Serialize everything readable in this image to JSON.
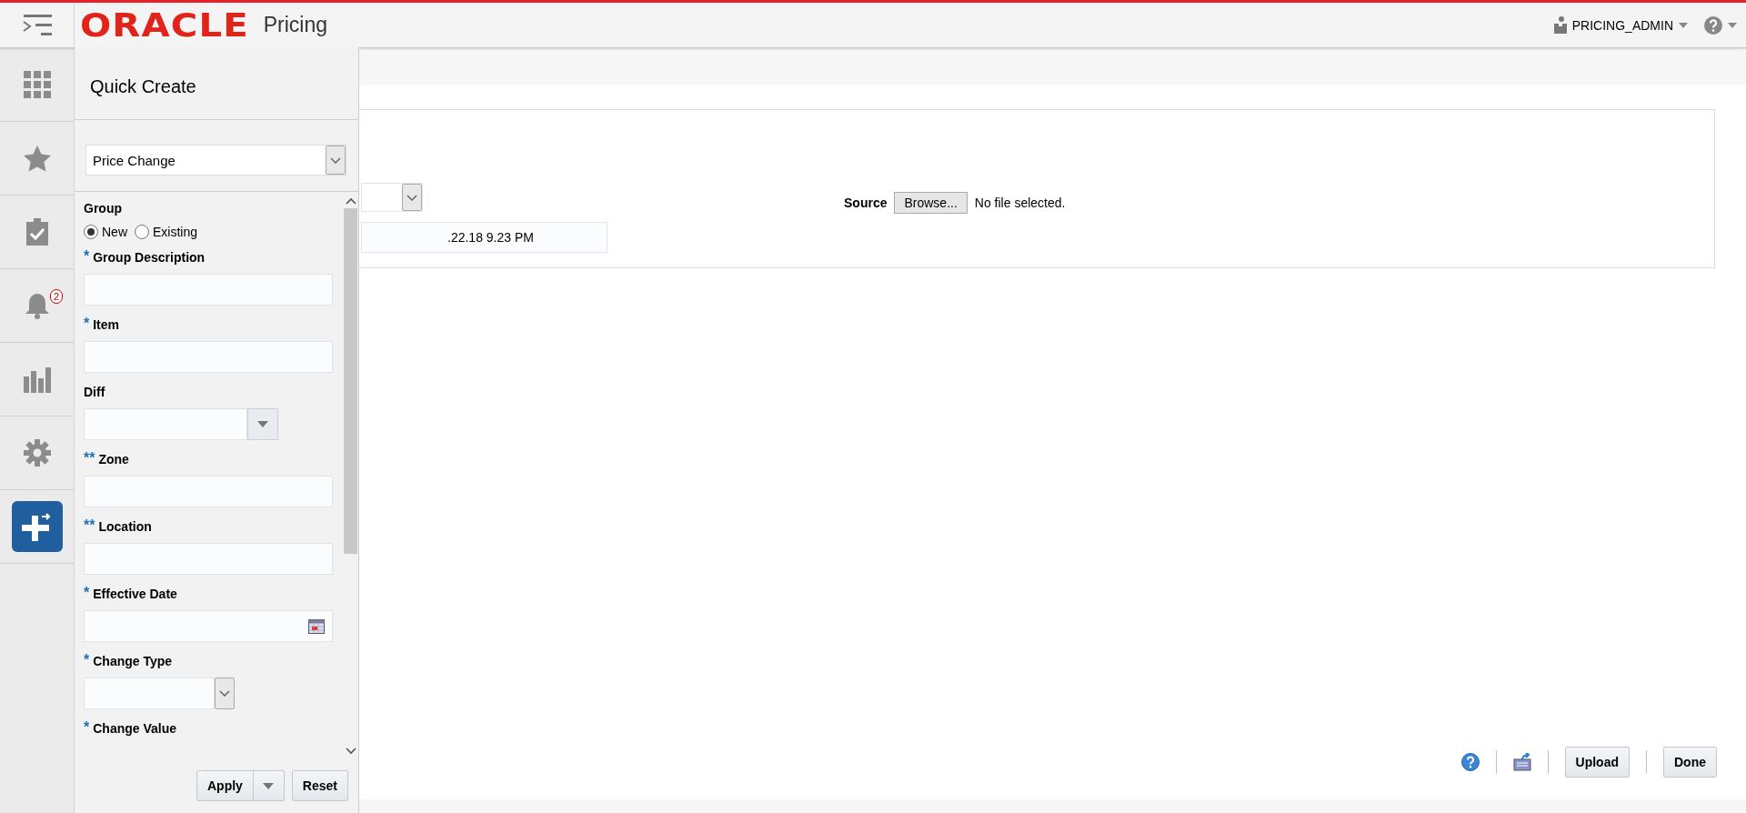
{
  "header": {
    "logo": "ORACLE",
    "title": "Pricing",
    "user": "PRICING_ADMIN"
  },
  "rail": [
    {
      "kind": "apps",
      "selected": false
    },
    {
      "kind": "favorites",
      "selected": false
    },
    {
      "kind": "tasks",
      "selected": false
    },
    {
      "kind": "notifications",
      "selected": false,
      "badge": "2"
    },
    {
      "kind": "reports",
      "selected": false
    },
    {
      "kind": "settings",
      "selected": false
    },
    {
      "kind": "create",
      "selected": true
    }
  ],
  "main": {
    "process_description": ".22.18 9.23 PM",
    "source": {
      "label": "Source",
      "button": "Browse...",
      "status": "No file selected."
    },
    "actions": [
      "Upload",
      "Done"
    ]
  },
  "quick_create": {
    "title": "Quick Create",
    "type": "Price Change",
    "group": {
      "label": "Group",
      "options": [
        {
          "label": "New",
          "selected": true
        },
        {
          "label": "Existing",
          "selected": false
        }
      ]
    },
    "fields": [
      {
        "label": "Group Description",
        "required": "*",
        "kind": "text"
      },
      {
        "label": "Item",
        "required": "*",
        "kind": "text"
      },
      {
        "label": "Diff",
        "kind": "combo"
      },
      {
        "label": "Zone",
        "required": "**",
        "kind": "text"
      },
      {
        "label": "Location",
        "required": "**",
        "kind": "text"
      },
      {
        "label": "Effective Date",
        "required": "*",
        "kind": "date"
      },
      {
        "label": "Change Type",
        "required": "*",
        "kind": "select"
      },
      {
        "label": "Change Value",
        "required": "*",
        "kind": "label"
      }
    ],
    "buttons": [
      "Apply",
      "Reset"
    ]
  }
}
